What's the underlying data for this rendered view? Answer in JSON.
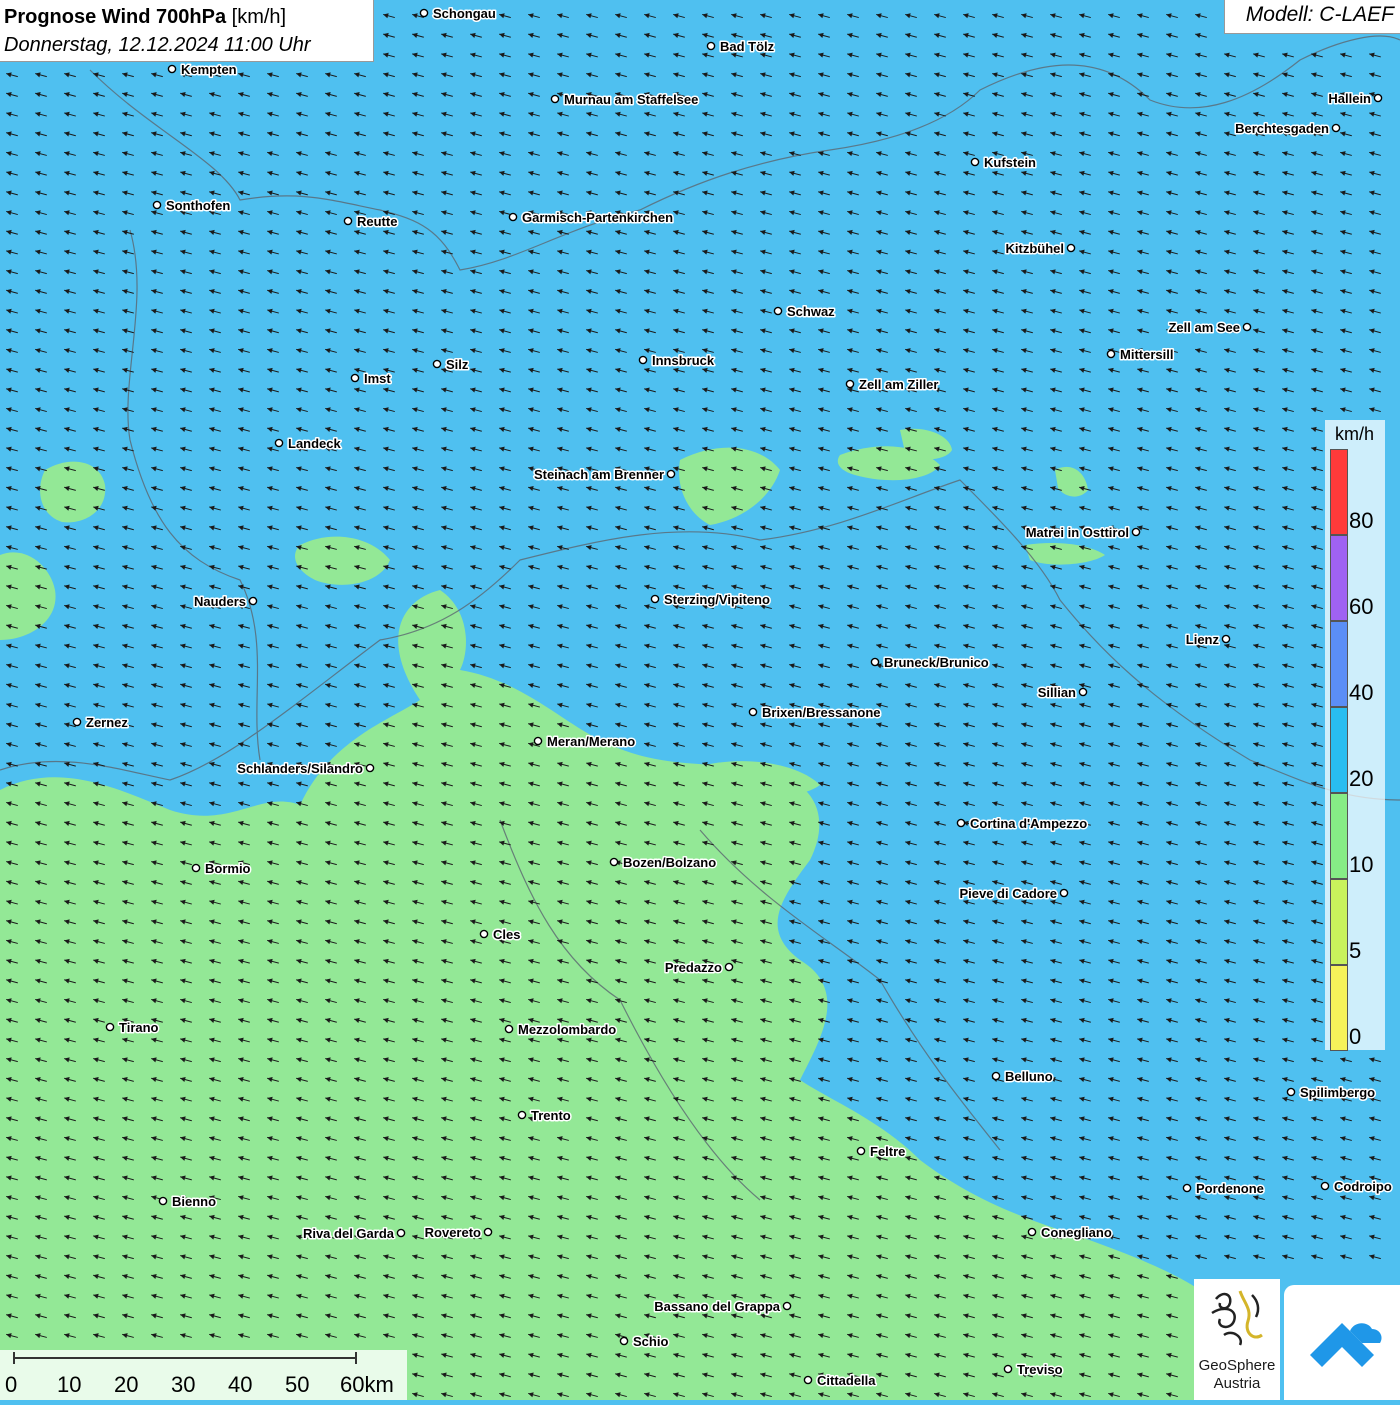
{
  "header": {
    "title_bold": "Prognose Wind 700hPa",
    "title_unit": " [km/h]",
    "subtitle": "Donnerstag, 12.12.2024 11:00 Uhr",
    "model": "Modell: C-LAEF"
  },
  "legend": {
    "unit": "km/h",
    "classes": [
      {
        "label": "80",
        "color": "#ff3a3a"
      },
      {
        "label": "60",
        "color": "#9f62f2"
      },
      {
        "label": "40",
        "color": "#5b8ef6"
      },
      {
        "label": "20",
        "color": "#29bdf0"
      },
      {
        "label": "10",
        "color": "#86ec86"
      },
      {
        "label": "5",
        "color": "#c9f25c"
      },
      {
        "label": "0",
        "color": "#f6f25a"
      }
    ]
  },
  "colors": {
    "field_main": "#4fc0f0",
    "field_light": "#93e896",
    "wind_arrow": "#1a1a1a",
    "border_line": "#5b6670"
  },
  "wind": {
    "direction": "from east-southeast, arrows pointing west-northwest"
  },
  "places": [
    {
      "name": "Schongau"
    },
    {
      "name": "Bad Tölz"
    },
    {
      "name": "Kempten"
    },
    {
      "name": "Murnau am Staffelsee"
    },
    {
      "name": "Hallein"
    },
    {
      "name": "Berchtesgaden"
    },
    {
      "name": "Kufstein"
    },
    {
      "name": "Sonthofen"
    },
    {
      "name": "Reutte"
    },
    {
      "name": "Garmisch-Partenkirchen"
    },
    {
      "name": "Kitzbühel"
    },
    {
      "name": "Schwaz"
    },
    {
      "name": "Zell am See"
    },
    {
      "name": "Imst"
    },
    {
      "name": "Silz"
    },
    {
      "name": "Innsbruck"
    },
    {
      "name": "Mittersill"
    },
    {
      "name": "Zell am Ziller"
    },
    {
      "name": "Landeck"
    },
    {
      "name": "Steinach am Brenner"
    },
    {
      "name": "Matrei in Osttirol"
    },
    {
      "name": "Nauders"
    },
    {
      "name": "Sterzing/Vipiteno"
    },
    {
      "name": "Lienz"
    },
    {
      "name": "Bruneck/Brunico"
    },
    {
      "name": "Sillian"
    },
    {
      "name": "Zernez"
    },
    {
      "name": "Brixen/Bressanone"
    },
    {
      "name": "Meran/Merano"
    },
    {
      "name": "Schlanders/Silandro"
    },
    {
      "name": "Cortina d'Ampezzo"
    },
    {
      "name": "Bozen/Bolzano"
    },
    {
      "name": "Bormio"
    },
    {
      "name": "Pieve di Cadore"
    },
    {
      "name": "Cles"
    },
    {
      "name": "Predazzo"
    },
    {
      "name": "Tirano"
    },
    {
      "name": "Mezzolombardo"
    },
    {
      "name": "Belluno"
    },
    {
      "name": "Spilimbergo"
    },
    {
      "name": "Trento"
    },
    {
      "name": "Feltre"
    },
    {
      "name": "Bienno"
    },
    {
      "name": "Pordenone"
    },
    {
      "name": "Codroipo"
    },
    {
      "name": "Riva del Garda"
    },
    {
      "name": "Rovereto"
    },
    {
      "name": "Conegliano"
    },
    {
      "name": "Bassano del Grappa"
    },
    {
      "name": "Schio"
    },
    {
      "name": "Treviso"
    },
    {
      "name": "Cittadella"
    }
  ],
  "scalebar": {
    "labels": [
      "0",
      "10",
      "20",
      "30",
      "40",
      "50",
      "60km"
    ]
  },
  "logos": {
    "geosphere_line1": "GeoSphere",
    "geosphere_line2": "Austria"
  }
}
